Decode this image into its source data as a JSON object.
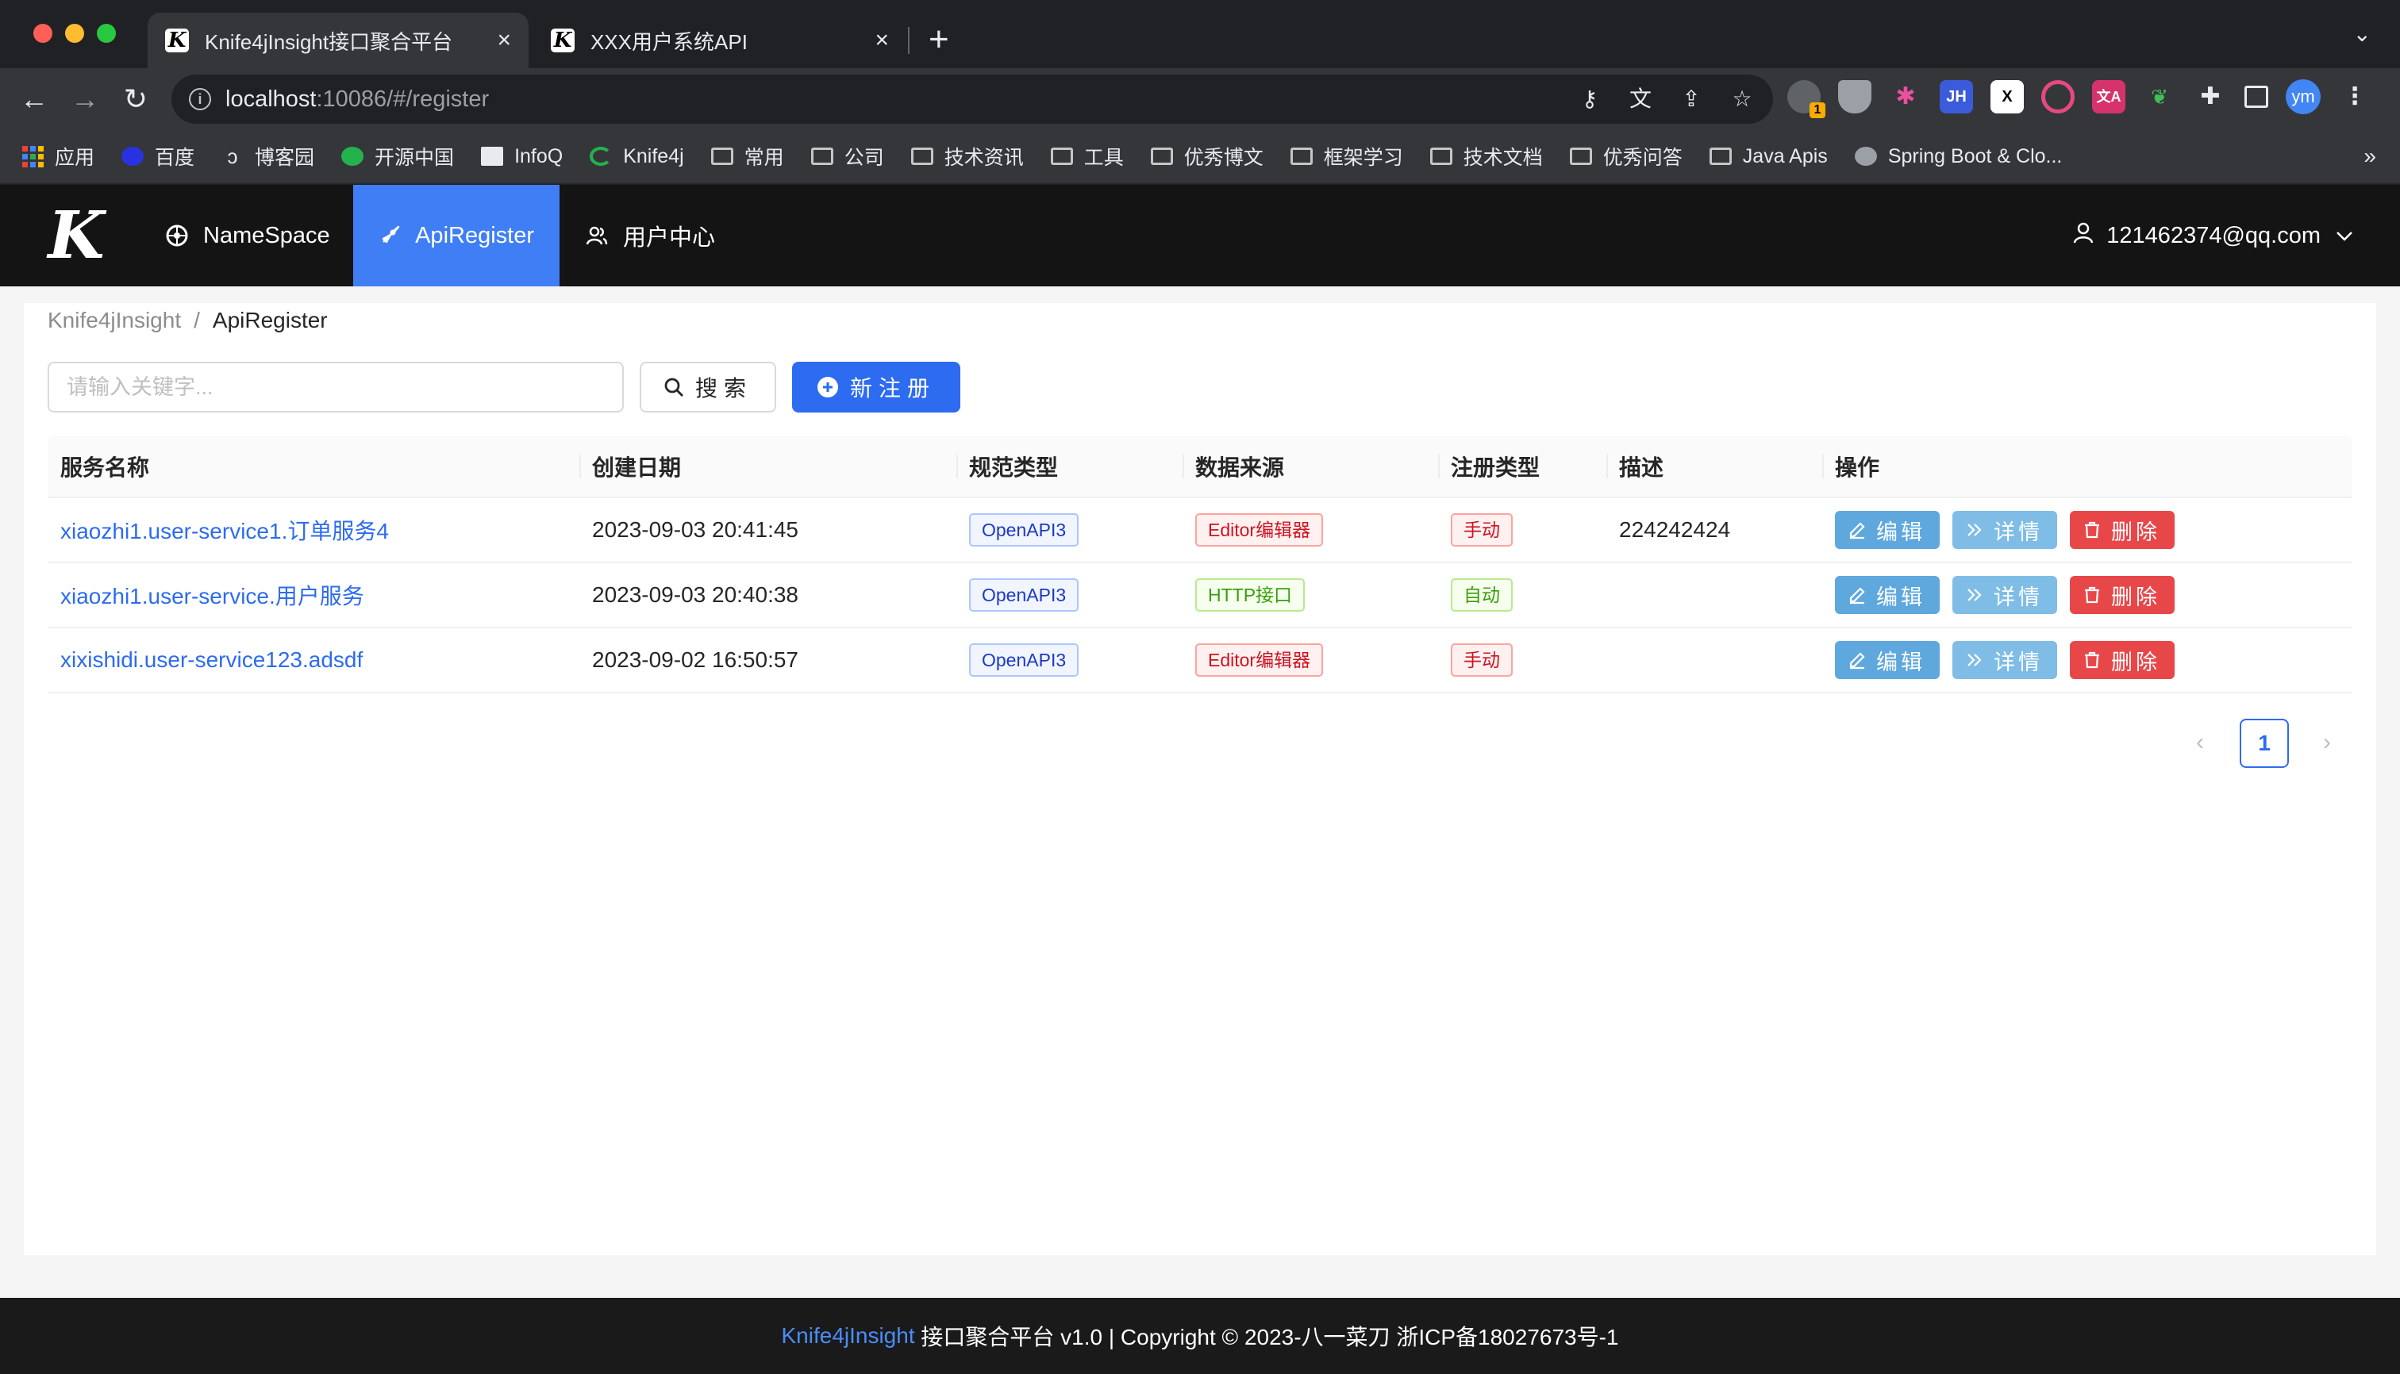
{
  "browser": {
    "tabs": [
      {
        "title": "Knife4jInsight接口聚合平台",
        "favicon": "K"
      },
      {
        "title": "XXX用户系统API",
        "favicon": "K"
      }
    ],
    "url_host": "localhost",
    "url_rest": ":10086/#/register",
    "profile_initials": "ym",
    "extension_badge": "1",
    "bookmarks": [
      {
        "label": "应用",
        "icon": "apps-icon"
      },
      {
        "label": "百度",
        "icon": "baidu-icon"
      },
      {
        "label": "博客园",
        "icon": "cnblogs-icon"
      },
      {
        "label": "开源中国",
        "icon": "oschina-icon"
      },
      {
        "label": "InfoQ",
        "icon": "infoq-icon"
      },
      {
        "label": "Knife4j",
        "icon": "knife4j-icon"
      },
      {
        "label": "常用",
        "icon": "folder-icon"
      },
      {
        "label": "公司",
        "icon": "folder-icon"
      },
      {
        "label": "技术资讯",
        "icon": "folder-icon"
      },
      {
        "label": "工具",
        "icon": "folder-icon"
      },
      {
        "label": "优秀博文",
        "icon": "folder-icon"
      },
      {
        "label": "框架学习",
        "icon": "folder-icon"
      },
      {
        "label": "技术文档",
        "icon": "folder-icon"
      },
      {
        "label": "优秀问答",
        "icon": "folder-icon"
      },
      {
        "label": "Java Apis",
        "icon": "folder-icon"
      },
      {
        "label": "Spring Boot & Clo...",
        "icon": "spring-icon"
      }
    ]
  },
  "app": {
    "logo": "K",
    "nav": [
      {
        "label": "NameSpace",
        "icon": "namespace-icon"
      },
      {
        "label": "ApiRegister",
        "icon": "rocket-icon",
        "active": true
      },
      {
        "label": "用户中心",
        "icon": "users-icon"
      }
    ],
    "user": "121462374@qq.com",
    "colors": {
      "primary": "#2d6bf0",
      "header_bg": "#141414",
      "danger": "#e8474a"
    }
  },
  "breadcrumb": {
    "root": "Knife4jInsight",
    "separator": "/",
    "current": "ApiRegister"
  },
  "toolbar": {
    "search_placeholder": "请输入关键字...",
    "search_label": "搜索",
    "new_label": "新注册"
  },
  "table": {
    "columns": [
      "服务名称",
      "创建日期",
      "规范类型",
      "数据来源",
      "注册类型",
      "描述",
      "操作"
    ],
    "rows": [
      {
        "name": "xiaozhi1.user-service1.订单服务4",
        "created": "2023-09-03 20:41:45",
        "spec": "OpenAPI3",
        "source": "Editor编辑器",
        "source_color": "red",
        "reg": "手动",
        "reg_color": "red",
        "desc": "224242424"
      },
      {
        "name": "xiaozhi1.user-service.用户服务",
        "created": "2023-09-03 20:40:38",
        "spec": "OpenAPI3",
        "source": "HTTP接口",
        "source_color": "green",
        "reg": "自动",
        "reg_color": "green",
        "desc": ""
      },
      {
        "name": "xixishidi.user-service123.adsdf",
        "created": "2023-09-02 16:50:57",
        "spec": "OpenAPI3",
        "source": "Editor编辑器",
        "source_color": "red",
        "reg": "手动",
        "reg_color": "red",
        "desc": ""
      }
    ],
    "actions": {
      "edit": "编辑",
      "detail": "详情",
      "delete": "删除"
    }
  },
  "pagination": {
    "current_page": "1"
  },
  "footer": {
    "brand": "Knife4jInsight",
    "text": " 接口聚合平台 v1.0 | Copyright © 2023-八一菜刀 浙ICP备18027673号-1"
  }
}
